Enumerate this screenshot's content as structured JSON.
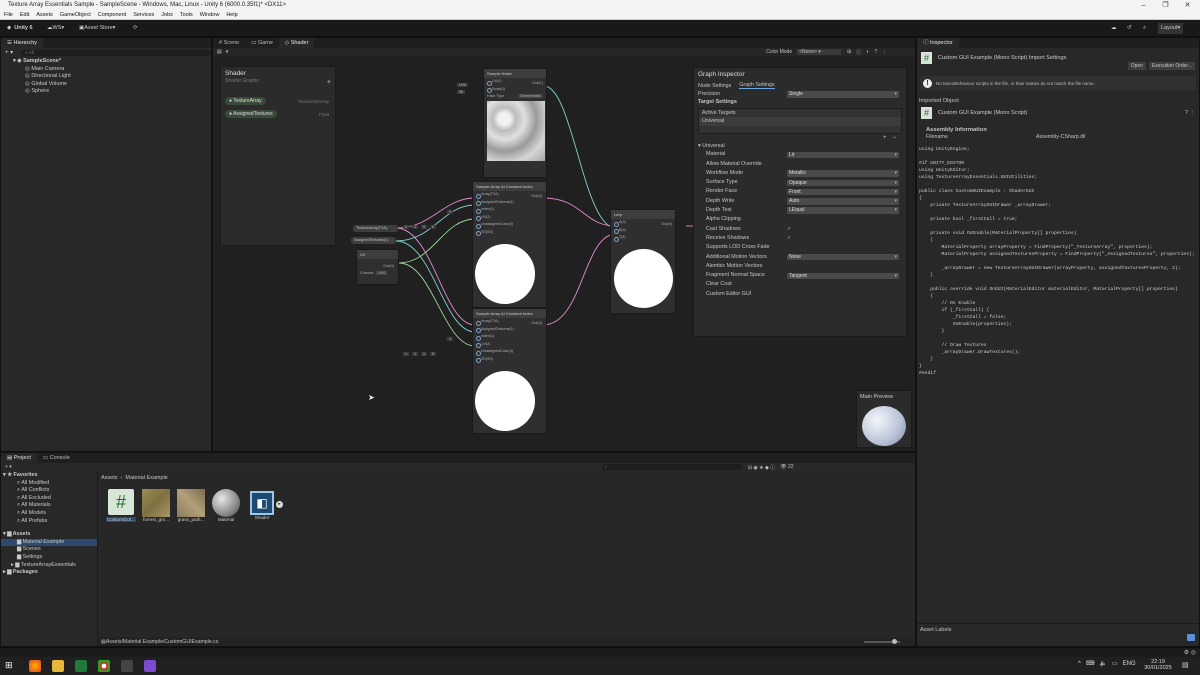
{
  "window": {
    "title": "Texture Array Essentials Sample - SampleScene - Windows, Mac, Linux - Unity 6 (6000.0.35f1)* <DX11>"
  },
  "menu": [
    "File",
    "Edit",
    "Assets",
    "GameObject",
    "Component",
    "Services",
    "Jobs",
    "Tools",
    "Window",
    "Help"
  ],
  "toolbar": {
    "unity": "Unity 6",
    "ws": "WS",
    "asset_store": "Asset Store",
    "layout": "Layout"
  },
  "hierarchy": {
    "tab": "Hierarchy",
    "search": "All",
    "scene": "SampleScene*",
    "items": [
      "Main Camera",
      "Directional Light",
      "Global Volume",
      "Sphere"
    ]
  },
  "scene_tabs": [
    "Scene",
    "Game",
    "Shader"
  ],
  "shader": {
    "color_mode_label": "Color Mode",
    "color_mode_value": "<None>",
    "blackboard_title": "Shader",
    "blackboard_sub": "Shader Graphs",
    "props": [
      {
        "name": "TextureArray",
        "type": "Texture2DArray"
      },
      {
        "name": "AssignedTextures",
        "type": "Float"
      }
    ]
  },
  "nodes": {
    "sample": {
      "title": "Sample Noise",
      "ports": [
        "UV(2)",
        "Scale(1)"
      ],
      "out": "Out(1)",
      "hash_type": "Hash Type",
      "hash_val": "Deterministic",
      "in1": "UV0",
      "in2": "30"
    },
    "arr1": {
      "title": "Sample Array At Constant Index",
      "ports": [
        "Array(T2A)",
        "AssignedTextures(1)",
        "Index(1)",
        "UV(2)",
        "UnassignedColor(4)",
        "SS(SS)"
      ],
      "out": "Out(4)"
    },
    "arr2": {
      "title": "Sample Array At Constant Index",
      "ports": [
        "Array(T2A)",
        "AssignedTextures(1)",
        "Index(1)",
        "UV(2)",
        "UnassignedColor(4)",
        "SS(SS)"
      ],
      "out": "Out(4)"
    },
    "lerp": {
      "title": "Lerp",
      "ports": [
        "A(4)",
        "B(4)",
        "T(4)"
      ],
      "out": "Out(4)"
    },
    "uv": {
      "title": "UV",
      "out": "Out(4)",
      "channel": "Channel",
      "channel_val": "UV0"
    },
    "texarr": "TextureArray(T2A)",
    "assigned": "AssignedTextures(1)",
    "idx1": "0",
    "idx2": "1",
    "vals1": [
      "0",
      "1",
      "0",
      "0"
    ],
    "vals2": [
      "1",
      "1",
      "1",
      "0"
    ]
  },
  "graph_inspector": {
    "title": "Graph Inspector",
    "tabs": [
      "Node Settings",
      "Graph Settings"
    ],
    "precision_label": "Precision",
    "precision": "Single",
    "target_settings": "Target Settings",
    "active_targets": "Active Targets",
    "target": "Universal",
    "section": "Universal",
    "rows": [
      {
        "label": "Material",
        "value": "Lit"
      },
      {
        "label": "Allow Material Override",
        "value": ""
      },
      {
        "label": "Workflow Mode",
        "value": "Metallic"
      },
      {
        "label": "Surface Type",
        "value": "Opaque"
      },
      {
        "label": "Render Face",
        "value": "Front"
      },
      {
        "label": "Depth Write",
        "value": "Auto"
      },
      {
        "label": "Depth Test",
        "value": "LEqual"
      },
      {
        "label": "Alpha Clipping",
        "value": ""
      },
      {
        "label": "Cast Shadows",
        "value": "✓"
      },
      {
        "label": "Receive Shadows",
        "value": "✓"
      },
      {
        "label": "Supports LOD Cross Fade",
        "value": ""
      },
      {
        "label": "Additional Motion Vectors",
        "value": "None"
      },
      {
        "label": "Alembic Motion Vectors",
        "value": ""
      },
      {
        "label": "Fragment Normal Space",
        "value": "Tangent"
      },
      {
        "label": "Clear Coat",
        "value": ""
      },
      {
        "label": "Custom Editor GUI",
        "value": ""
      }
    ]
  },
  "main_preview": "Main Preview",
  "inspector": {
    "tab": "Inspector",
    "title": "Custom GUI Example (Mono Script) Import Settings",
    "open": "Open",
    "exec_order": "Execution Order...",
    "warning": "No MonoBehaviour scripts in the file, or their names do not match the file name.",
    "imported_object": "Imported Object",
    "obj_title": "Custom GUI Example (Mono Script)",
    "assembly_info": "Assembly Information",
    "filename_label": "Filename",
    "filename": "Assembly-CSharp.dll",
    "asset_labels": "Asset Labels",
    "code": "using UnityEngine;\n\n#if UNITY_EDITOR\nusing UnityEditor;\nusing TextureArrayEssentials.GUIUtilities;\n\npublic class CustomGUIExample : ShaderGUI\n{\n    private TextureArrayGUIDrawer _arrayDrawer;\n\n    private bool _firstCall = true;\n\n    private void OnEnable(MaterialProperty[] properties)\n    {\n        MaterialProperty arrayProperty = FindProperty(\"_TextureArray\", properties);\n        MaterialProperty assignedTexturesProperty = FindProperty(\"_AssignedTextures\", properties);\n\n        _arrayDrawer = new TextureArrayGUIDrawer(arrayProperty, assignedTexturesProperty, 2);\n    }\n\n    public override void OnGUI(MaterialEditor materialEditor, MaterialProperty[] properties)\n    {\n        // On Enable\n        if (_firstCall) {\n            _firstCall = false;\n            OnEnable(properties);\n        }\n\n        // Draw Textures\n        _arrayDrawer.DrawTextures();\n    }\n}\n#endif"
  },
  "project": {
    "tabs": [
      "Project",
      "Console"
    ],
    "favorites": "Favorites",
    "fav_items": [
      "All Modified",
      "All Conflicts",
      "All Excluded",
      "All Materials",
      "All Models",
      "All Prefabs"
    ],
    "assets": "Assets",
    "asset_items": [
      "Material Example",
      "Scenes",
      "Settings",
      "TextureArrayEssentials"
    ],
    "packages": "Packages",
    "breadcrumb": [
      "Assets",
      "Material Example"
    ],
    "files": [
      "CustomGUI...",
      "forrest_gro...",
      "grass_path...",
      "Material",
      "Shader"
    ],
    "path": "Assets/Material Example/CustomGUIExample.cs",
    "count": "22"
  },
  "taskbar": {
    "lang": "ENG",
    "time": "22:19",
    "date": "30/01/2025"
  }
}
